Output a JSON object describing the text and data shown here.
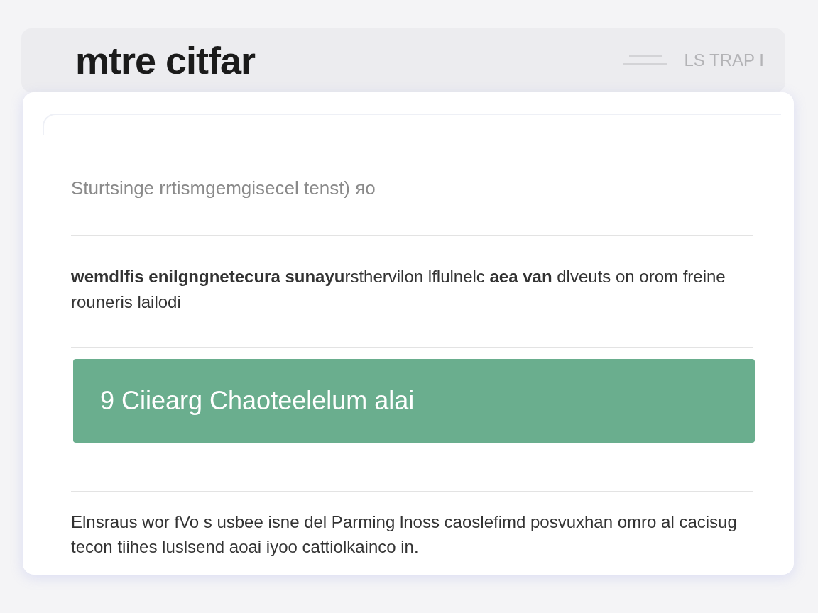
{
  "header": {
    "title": "mtre citfar",
    "link": "LS TRAP I"
  },
  "card": {
    "subtitle": "Sturtsinge rrtismgemgisecel tenst) ᴙo",
    "intro": "**wemdlfis enilgngnetecura sunayu**rsthervilon lflulnelc **aea van** dlveuts on orom freine rouneris lailodi",
    "action": "9 Ciiearg Chaoteelelum alai",
    "footer": "Elnsraus wor fVo s usbee isne del Parming lnoss caoslefimd posvuxhan omro al cacisug tecon tiihes luslsend aoai iyoo cattiolkainco in."
  }
}
